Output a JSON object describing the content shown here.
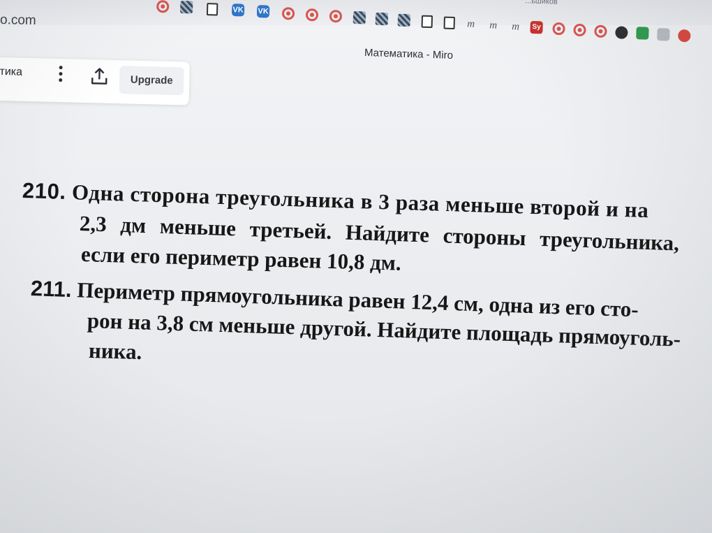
{
  "browser": {
    "url_fragment": "o.com",
    "top_right_label": "...ьшиков",
    "bookmarks": [
      {
        "icon": "vk-icon",
        "label": "VK"
      },
      {
        "icon": "vk-icon",
        "label": "VK"
      },
      {
        "icon": "target-icon",
        "label": ""
      },
      {
        "icon": "target-icon",
        "label": ""
      },
      {
        "icon": "target-icon",
        "label": ""
      },
      {
        "icon": "grid-icon",
        "label": ""
      },
      {
        "icon": "grid-icon",
        "label": ""
      },
      {
        "icon": "grid-icon",
        "label": ""
      },
      {
        "icon": "document-icon",
        "label": ""
      },
      {
        "icon": "document-icon",
        "label": ""
      },
      {
        "icon": "m-icon",
        "label": "m"
      },
      {
        "icon": "m-icon",
        "label": "m"
      },
      {
        "icon": "m-icon",
        "label": "m"
      },
      {
        "icon": "sy-icon",
        "label": "Sy"
      },
      {
        "icon": "target-icon",
        "label": ""
      },
      {
        "icon": "target-icon",
        "label": ""
      },
      {
        "icon": "target-icon",
        "label": ""
      },
      {
        "icon": "extension-icon",
        "label": ""
      },
      {
        "icon": "extension-icon",
        "label": ""
      },
      {
        "icon": "extension-icon",
        "label": ""
      },
      {
        "icon": "extension-icon",
        "label": ""
      }
    ]
  },
  "miro": {
    "tab_title": "Математика - Miro",
    "board_name": "тика",
    "upgrade_label": "Upgrade"
  },
  "problems": [
    {
      "number": "210.",
      "lines": [
        "Одна сторона треугольника в 3 раза меньше второй и на",
        "2,3 дм меньше третьей. Найдите стороны треугольника,",
        "если его периметр равен 10,8 дм."
      ]
    },
    {
      "number": "211.",
      "lines": [
        "Периметр прямоугольника равен 12,4 см, одна из его сто-",
        "рон на 3,8 см меньше другой. Найдите площадь прямоуголь-",
        "ника."
      ]
    }
  ]
}
